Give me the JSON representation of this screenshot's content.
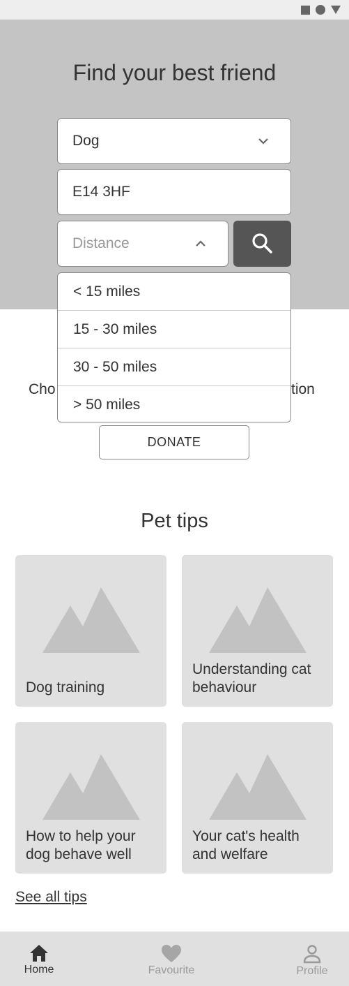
{
  "status_bar": {
    "icons": [
      "square-icon",
      "circle-icon",
      "triangle-icon"
    ]
  },
  "hero": {
    "title": "Find your best friend",
    "pet_select": {
      "value": "Dog"
    },
    "postcode": {
      "value": "E14 3HF"
    },
    "distance": {
      "placeholder": "Distance",
      "expanded": true
    },
    "search_icon": "search-icon"
  },
  "distance_options": [
    "< 15 miles",
    "15 - 30 miles",
    "30 - 50 miles",
    "> 50 miles"
  ],
  "donation": {
    "partial_left": "Cho",
    "partial_right": "tion",
    "button_label": "DONATE"
  },
  "tips": {
    "title": "Pet tips",
    "cards": [
      {
        "label": "Dog training"
      },
      {
        "label": "Understanding cat behaviour"
      },
      {
        "label": "How to help your dog behave well"
      },
      {
        "label": "Your cat's health and welfare"
      }
    ],
    "see_all": "See all tips"
  },
  "bottom_nav": {
    "items": [
      {
        "label": "Home",
        "icon": "home-icon",
        "active": true
      },
      {
        "label": "Favourite",
        "icon": "heart-icon",
        "active": false
      },
      {
        "label": "Profile",
        "icon": "person-icon",
        "active": false
      }
    ]
  },
  "colors": {
    "hero_bg": "#c4c4c4",
    "search_button": "#555555",
    "card_bg": "#e0e0e0",
    "nav_bg": "#e0e0e0",
    "text": "#333333",
    "muted_text": "#999999"
  }
}
